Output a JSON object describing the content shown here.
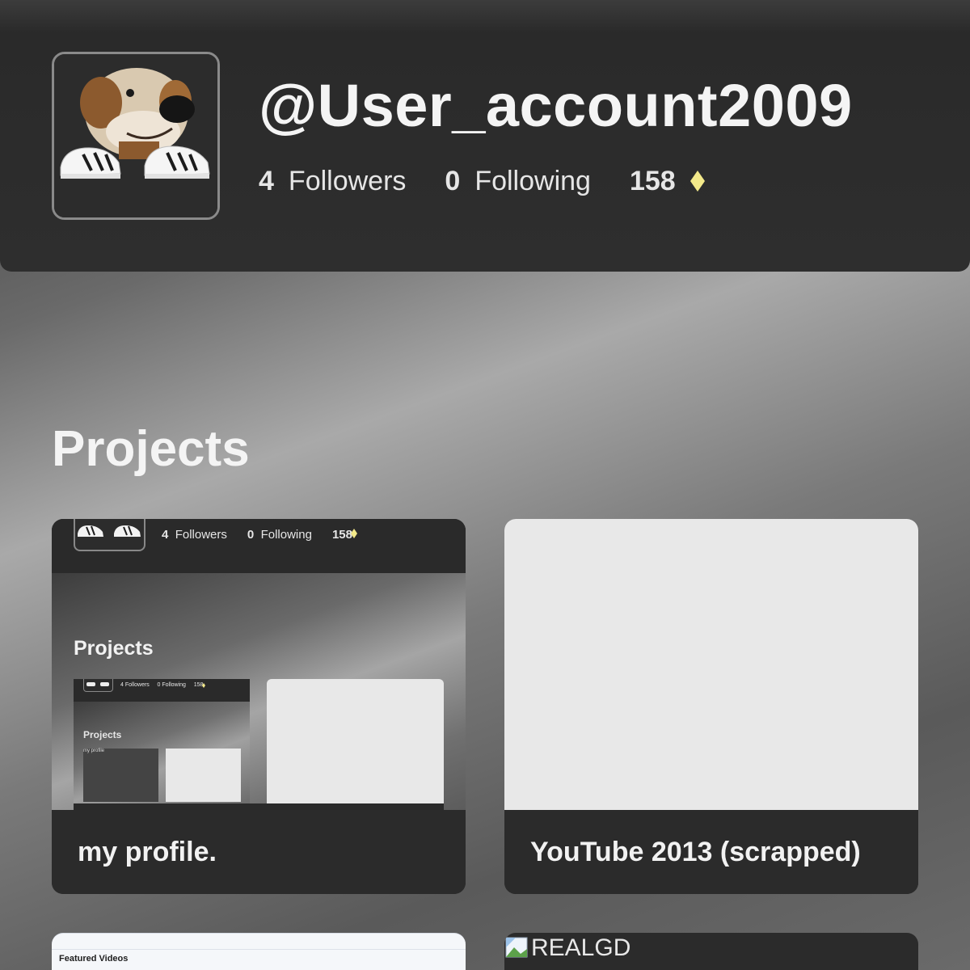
{
  "profile": {
    "username": "@User_account2009",
    "followers_count": "4",
    "followers_label": "Followers",
    "following_count": "0",
    "following_label": "Following",
    "gems_count": "158",
    "gem_icon": "diamond-icon",
    "gem_color": "#f3e98a"
  },
  "projects": {
    "title": "Projects",
    "items": [
      {
        "title": "my profile.",
        "preview": {
          "followers_count": "4",
          "followers_label": "Followers",
          "following_count": "0",
          "following_label": "Following",
          "gems_count": "158",
          "title": "Projects",
          "nested_followers": "4 Followers",
          "nested_following": "0 Following",
          "nested_gems": "158",
          "nested_title": "Projects",
          "nested_alt": "my profile"
        }
      },
      {
        "title": "YouTube 2013 (scrapped)"
      }
    ],
    "more": [
      {
        "preview_text": "Featured Videos"
      },
      {
        "broken_image_alt": "REALGD"
      }
    ]
  }
}
